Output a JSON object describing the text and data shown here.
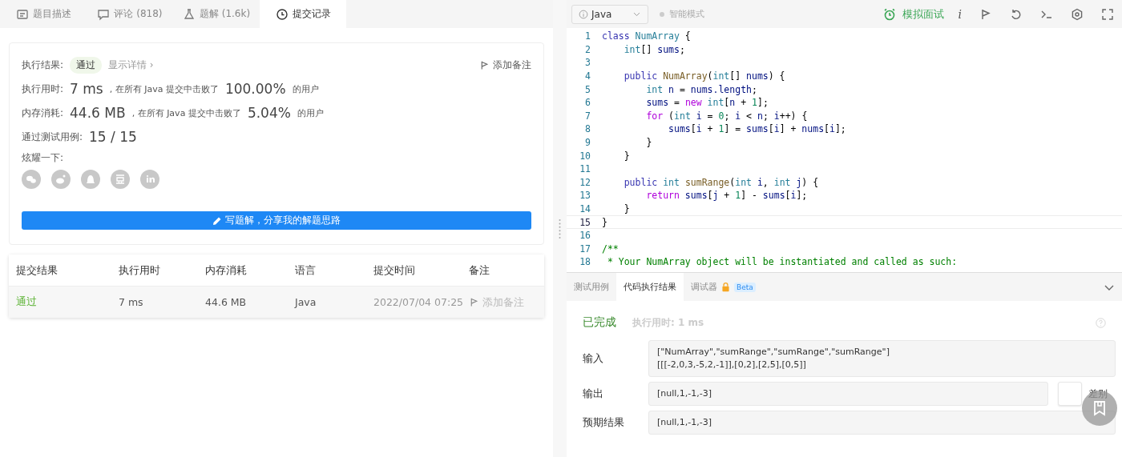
{
  "left_tabs": [
    {
      "label": "题目描述",
      "selected": false
    },
    {
      "label": "评论 (818)",
      "selected": false
    },
    {
      "label": "题解 (1.6k)",
      "selected": false
    },
    {
      "label": "提交记录",
      "selected": true
    }
  ],
  "result_card": {
    "result_label": "执行结果:",
    "result_badge": "通过",
    "details_link": "显示详情 ›",
    "note_button": "添加备注",
    "stats": [
      {
        "label": "执行用时:",
        "value": "7 ms",
        "middle": ", 在所有 Java 提交中击败了",
        "percent": "100.00%",
        "tail": "的用户"
      },
      {
        "label": "内存消耗:",
        "value": "44.6 MB",
        "middle": ", 在所有 Java 提交中击败了",
        "percent": "5.04%",
        "tail": "的用户"
      }
    ],
    "cases_label": "通过测试用例:",
    "cases_value": "15 / 15",
    "share_label": "炫耀一下:",
    "write_button": "写题解，分享我的解题思路"
  },
  "submissions": {
    "columns": [
      "提交结果",
      "执行用时",
      "内存消耗",
      "语言",
      "提交时间",
      "备注"
    ],
    "rows": [
      {
        "status": "通过",
        "runtime": "7 ms",
        "memory": "44.6 MB",
        "language": "Java",
        "time": "2022/07/04 07:25",
        "note": "添加备注"
      }
    ]
  },
  "editor_toolbar": {
    "language": "Java",
    "smart_mode": "智能模式",
    "interview": "模拟面试",
    "info_glyph": "i"
  },
  "code": [
    {
      "number": "1",
      "current": false,
      "tokens": [
        {
          "kind": "keyword",
          "text": "class"
        },
        {
          "kind": "type",
          "text": " NumArray"
        },
        {
          "kind": "plain",
          "text": " {"
        }
      ]
    },
    {
      "number": "2",
      "current": false,
      "tokens": [
        {
          "kind": "type",
          "text": "    int"
        },
        {
          "kind": "plain",
          "text": "[]"
        },
        {
          "kind": "variable",
          "text": " sums"
        },
        {
          "kind": "plain",
          "text": ";"
        }
      ]
    },
    {
      "number": "3",
      "current": false
    },
    {
      "number": "4",
      "current": false,
      "tokens": [
        {
          "kind": "keyword",
          "text": "    public"
        },
        {
          "kind": "function",
          "text": " NumArray"
        },
        {
          "kind": "plain",
          "text": "("
        },
        {
          "kind": "type",
          "text": "int"
        },
        {
          "kind": "plain",
          "text": "[]"
        },
        {
          "kind": "variable",
          "text": " nums"
        },
        {
          "kind": "plain",
          "text": ") {"
        }
      ]
    },
    {
      "number": "5",
      "current": false,
      "tokens": [
        {
          "kind": "type",
          "text": "        int"
        },
        {
          "kind": "variable",
          "text": " n"
        },
        {
          "kind": "plain",
          "text": " ="
        },
        {
          "kind": "variable",
          "text": " nums.length"
        },
        {
          "kind": "plain",
          "text": ";"
        }
      ]
    },
    {
      "number": "6",
      "current": false,
      "tokens": [
        {
          "kind": "variable",
          "text": "        sums"
        },
        {
          "kind": "plain",
          "text": " ="
        },
        {
          "kind": "control",
          "text": " new"
        },
        {
          "kind": "type",
          "text": " int"
        },
        {
          "kind": "plain",
          "text": "["
        },
        {
          "kind": "variable",
          "text": "n"
        },
        {
          "kind": "plain",
          "text": " +"
        },
        {
          "kind": "number",
          "text": " 1"
        },
        {
          "kind": "plain",
          "text": "];"
        }
      ]
    },
    {
      "number": "7",
      "current": false,
      "tokens": [
        {
          "kind": "control",
          "text": "        for"
        },
        {
          "kind": "plain",
          "text": " ("
        },
        {
          "kind": "type",
          "text": "int"
        },
        {
          "kind": "variable",
          "text": " i"
        },
        {
          "kind": "plain",
          "text": " ="
        },
        {
          "kind": "number",
          "text": " 0"
        },
        {
          "kind": "plain",
          "text": ";"
        },
        {
          "kind": "variable",
          "text": " i"
        },
        {
          "kind": "plain",
          "text": " <"
        },
        {
          "kind": "variable",
          "text": " n"
        },
        {
          "kind": "plain",
          "text": ";"
        },
        {
          "kind": "variable",
          "text": " i"
        },
        {
          "kind": "plain",
          "text": "++) {"
        }
      ]
    },
    {
      "number": "8",
      "current": false,
      "tokens": [
        {
          "kind": "variable",
          "text": "            sums"
        },
        {
          "kind": "plain",
          "text": "["
        },
        {
          "kind": "variable",
          "text": "i"
        },
        {
          "kind": "plain",
          "text": " +"
        },
        {
          "kind": "number",
          "text": " 1"
        },
        {
          "kind": "plain",
          "text": "] ="
        },
        {
          "kind": "variable",
          "text": " sums"
        },
        {
          "kind": "plain",
          "text": "["
        },
        {
          "kind": "variable",
          "text": "i"
        },
        {
          "kind": "plain",
          "text": "] +"
        },
        {
          "kind": "variable",
          "text": " nums"
        },
        {
          "kind": "plain",
          "text": "["
        },
        {
          "kind": "variable",
          "text": "i"
        },
        {
          "kind": "plain",
          "text": "];"
        }
      ]
    },
    {
      "number": "9",
      "current": false,
      "tokens": [
        {
          "kind": "plain",
          "text": "        }"
        }
      ]
    },
    {
      "number": "10",
      "current": false,
      "tokens": [
        {
          "kind": "plain",
          "text": "    }"
        }
      ]
    },
    {
      "number": "11",
      "current": false
    },
    {
      "number": "12",
      "current": false,
      "tokens": [
        {
          "kind": "keyword",
          "text": "    public"
        },
        {
          "kind": "type",
          "text": " int"
        },
        {
          "kind": "function",
          "text": " sumRange"
        },
        {
          "kind": "plain",
          "text": "("
        },
        {
          "kind": "type",
          "text": "int"
        },
        {
          "kind": "variable",
          "text": " i"
        },
        {
          "kind": "plain",
          "text": ","
        },
        {
          "kind": "type",
          "text": " int"
        },
        {
          "kind": "variable",
          "text": " j"
        },
        {
          "kind": "plain",
          "text": ") {"
        }
      ]
    },
    {
      "number": "13",
      "current": false,
      "tokens": [
        {
          "kind": "control",
          "text": "        return"
        },
        {
          "kind": "variable",
          "text": " sums"
        },
        {
          "kind": "plain",
          "text": "["
        },
        {
          "kind": "variable",
          "text": "j"
        },
        {
          "kind": "plain",
          "text": " +"
        },
        {
          "kind": "number",
          "text": " 1"
        },
        {
          "kind": "plain",
          "text": "] -"
        },
        {
          "kind": "variable",
          "text": " sums"
        },
        {
          "kind": "plain",
          "text": "["
        },
        {
          "kind": "variable",
          "text": "i"
        },
        {
          "kind": "plain",
          "text": "];"
        }
      ]
    },
    {
      "number": "14",
      "current": false,
      "tokens": [
        {
          "kind": "plain",
          "text": "    }"
        }
      ]
    },
    {
      "number": "15",
      "current": true,
      "tokens": [
        {
          "kind": "plain",
          "text": "}"
        }
      ]
    },
    {
      "number": "16",
      "current": false
    },
    {
      "number": "17",
      "current": false,
      "tokens": [
        {
          "kind": "comment",
          "text": "/**"
        }
      ]
    },
    {
      "number": "18",
      "current": false,
      "tokens": [
        {
          "kind": "comment",
          "text": " * Your NumArray object will be instantiated and called as such:"
        }
      ]
    }
  ],
  "bottom_tabs": [
    {
      "label": "测试用例",
      "selected": false,
      "beta": false
    },
    {
      "label": "代码执行结果",
      "selected": true,
      "beta": false
    },
    {
      "label": "调试器",
      "selected": false,
      "beta": true,
      "badge": "Beta"
    }
  ],
  "run_result": {
    "status": "已完成",
    "runtime": "执行用时: 1 ms",
    "rows": [
      {
        "label": "输入",
        "lines": [
          "[\"NumArray\",\"sumRange\",\"sumRange\",\"sumRange\"]",
          "[[[-2,0,3,-5,2,-1]],[0,2],[2,5],[0,5]]"
        ]
      },
      {
        "label": "输出",
        "lines": [
          "[null,1,-1,-3]"
        ],
        "diff": {
          "label": "差别",
          "on": false
        }
      },
      {
        "label": "预期结果",
        "lines": [
          "[null,1,-1,-3]"
        ]
      }
    ]
  }
}
